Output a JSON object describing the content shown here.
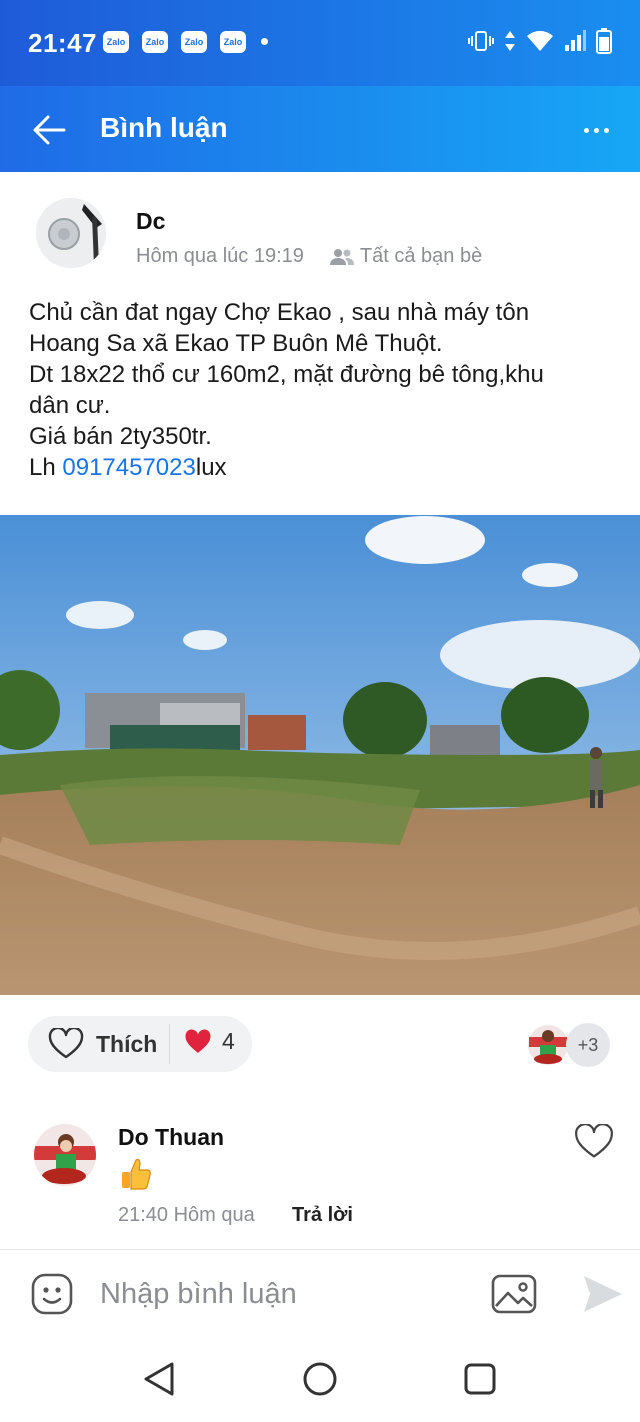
{
  "status_bar": {
    "time": "21:47",
    "notification_apps": [
      "Zalo",
      "Zalo",
      "Zalo",
      "Zalo"
    ],
    "icons": [
      "vibrate-icon",
      "data-arrows-icon",
      "wifi-icon",
      "signal-icon",
      "battery-icon"
    ]
  },
  "header": {
    "title": "Bình luận",
    "back_icon": "arrow-left-icon",
    "more_icon": "more-dots-icon"
  },
  "post": {
    "author": "Dc",
    "time": "Hôm qua lúc 19:19",
    "privacy_icon": "friends-icon",
    "privacy": "Tất cả bạn bè",
    "lines": [
      "Chủ cần đat ngay Chợ Ekao , sau nhà máy tôn",
      "Hoang Sa xã Ekao TP Buôn Mê Thuột.",
      "Dt 18x22 thổ cư 160m2, mặt đường bê tông,khu",
      "dân cư.",
      "Giá bán 2ty350tr."
    ],
    "contact_prefix": "Lh ",
    "phone": "0917457023",
    "contact_suffix": "lux"
  },
  "reactions": {
    "like_label": "Thích",
    "like_icon": "heart-outline-icon",
    "reaction_icon": "red-heart-icon",
    "count": "4",
    "more_reactors": "+3"
  },
  "comment": {
    "author": "Do Thuan",
    "content_icon": "thumbs-up-emoji",
    "time": "21:40 Hôm qua",
    "reply_label": "Trả lời"
  },
  "input_bar": {
    "placeholder": "Nhập bình luận",
    "icons": [
      "sticker-icon",
      "image-icon",
      "send-icon"
    ]
  },
  "nav_bar": {
    "icons": [
      "back-triangle-icon",
      "home-circle-icon",
      "recents-square-icon"
    ]
  },
  "colors": {
    "header_start": "#1f6be6",
    "header_end": "#17a7f6",
    "link": "#1a73e8",
    "heart": "#e0243d",
    "muted_text": "#8a8d91"
  }
}
